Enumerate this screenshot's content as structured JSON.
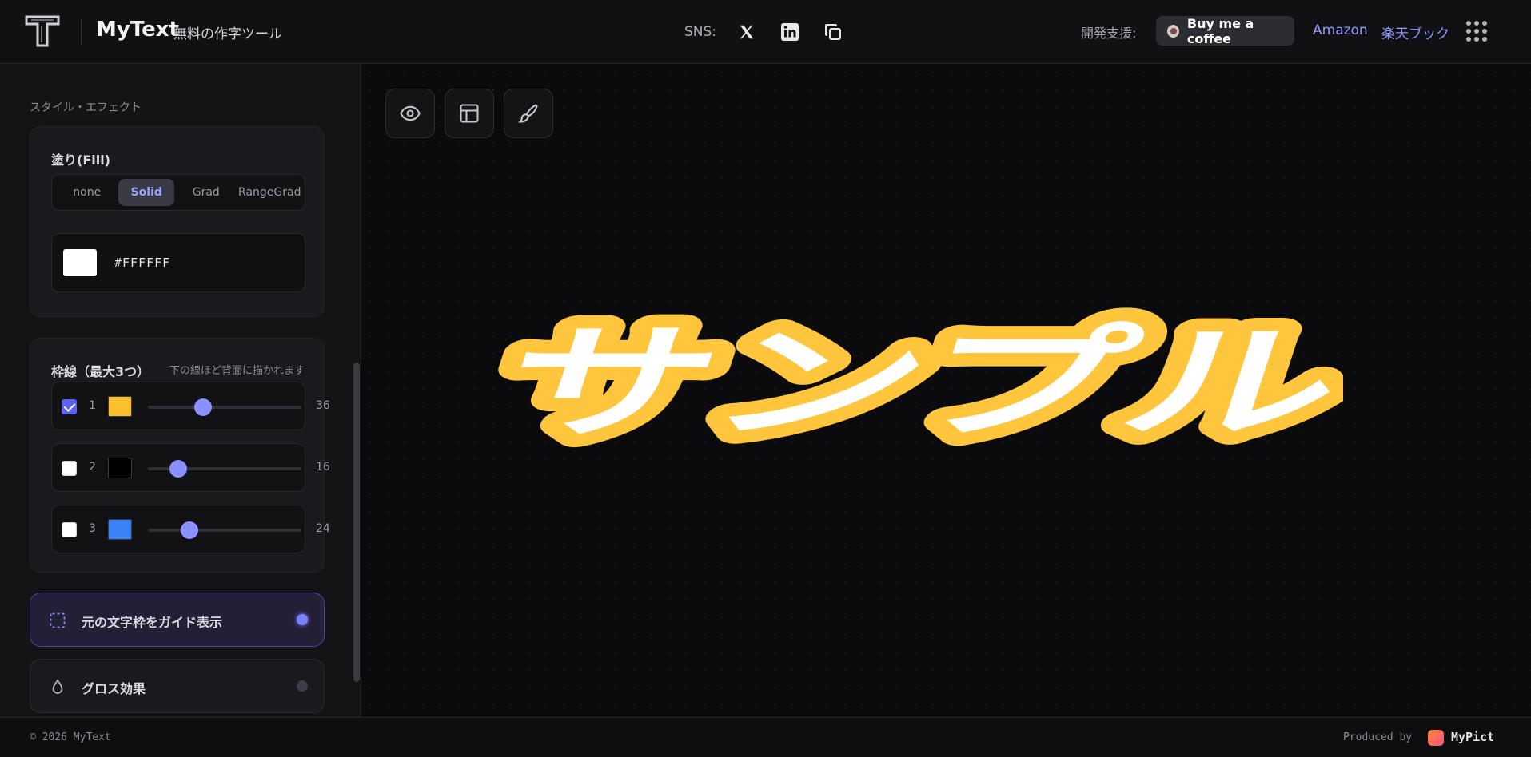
{
  "header": {
    "brand_title": "MyText",
    "brand_sub": "無料の作字ツール",
    "sns_label": "SNS:",
    "support_label": "開発支援:",
    "coffee_label": "Buy me a coffee",
    "amazon_label": "Amazon",
    "rakuten_label": "楽天ブック"
  },
  "sidebar": {
    "section_title": "スタイル・エフェクト",
    "fill": {
      "title": "塗り(Fill)",
      "modes": [
        "none",
        "Solid",
        "Grad",
        "RangeGrad"
      ],
      "active_mode": "Solid",
      "color": "#FFFFFF"
    },
    "stroke": {
      "title": "枠線（最大3つ）",
      "hint": "下の線ほど背面に描かれます",
      "rows": [
        {
          "num": "1",
          "checked": true,
          "color": "#FBC02D",
          "value": "36",
          "fraction": 0.36
        },
        {
          "num": "2",
          "checked": false,
          "color": "#000000",
          "value": "16",
          "fraction": 0.2
        },
        {
          "num": "3",
          "checked": false,
          "color": "#3B82F6",
          "value": "24",
          "fraction": 0.27
        }
      ]
    },
    "guide_toggle": {
      "label": "元の文字枠をガイド表示",
      "on": true
    },
    "gloss_toggle": {
      "label": "グロス効果",
      "on": false
    }
  },
  "canvas": {
    "preview_text": "サンプル",
    "stroke_color": "#FFC53D",
    "fill_color": "#FFFFFF"
  },
  "footer": {
    "copyright": "© 2026 MyText",
    "produced_by": "Produced by",
    "mypict": "MyPict"
  },
  "colors": {
    "accent": "#7C82FF",
    "background": "#0B0B0D"
  }
}
